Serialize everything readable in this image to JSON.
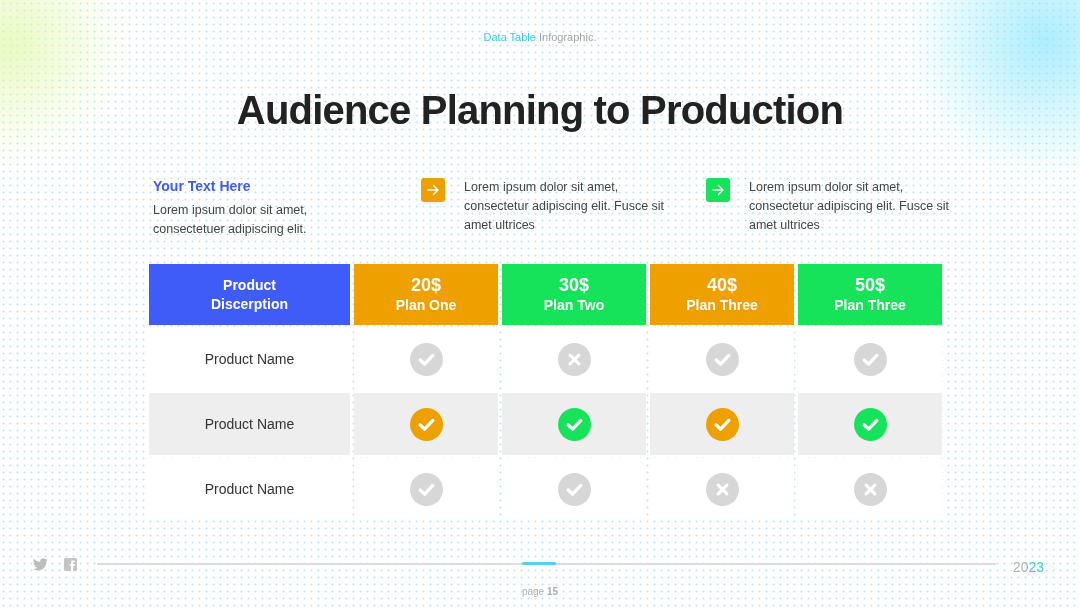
{
  "header": {
    "kicker_highlight": "Data Table",
    "kicker_rest": "Infographic.",
    "title": "Audience Planning to Production"
  },
  "intro": {
    "heading": "Your Text Here",
    "body": "Lorem ipsum dolor sit amet, consectetuer adipiscing elit."
  },
  "notes": [
    {
      "color": "#eea000",
      "text": "Lorem ipsum dolor sit amet, consectetur adipiscing elit. Fusce sit amet ultrices"
    },
    {
      "color": "#17e35a",
      "text": "Lorem ipsum dolor sit amet, consectetur adipiscing elit. Fusce sit amet ultrices"
    }
  ],
  "table": {
    "corner_label": "Product Discerption",
    "plans": [
      {
        "price": "20$",
        "name": "Plan One",
        "color": "#eea000"
      },
      {
        "price": "30$",
        "name": "Plan Two",
        "color": "#17e35a"
      },
      {
        "price": "40$",
        "name": "Plan Three",
        "color": "#eea000"
      },
      {
        "price": "50$",
        "name": "Plan Three",
        "color": "#17e35a"
      }
    ],
    "rows": [
      {
        "name": "Product Name",
        "highlighted": false,
        "cells": [
          {
            "included": true
          },
          {
            "included": false
          },
          {
            "included": true
          },
          {
            "included": true
          }
        ]
      },
      {
        "name": "Product Name",
        "highlighted": true,
        "cells": [
          {
            "included": true
          },
          {
            "included": true
          },
          {
            "included": true
          },
          {
            "included": true
          }
        ]
      },
      {
        "name": "Product Name",
        "highlighted": false,
        "cells": [
          {
            "included": true
          },
          {
            "included": true
          },
          {
            "included": false
          },
          {
            "included": false
          }
        ]
      }
    ]
  },
  "footer": {
    "page": "page **15**",
    "year_start": "20",
    "year_end": "23"
  }
}
